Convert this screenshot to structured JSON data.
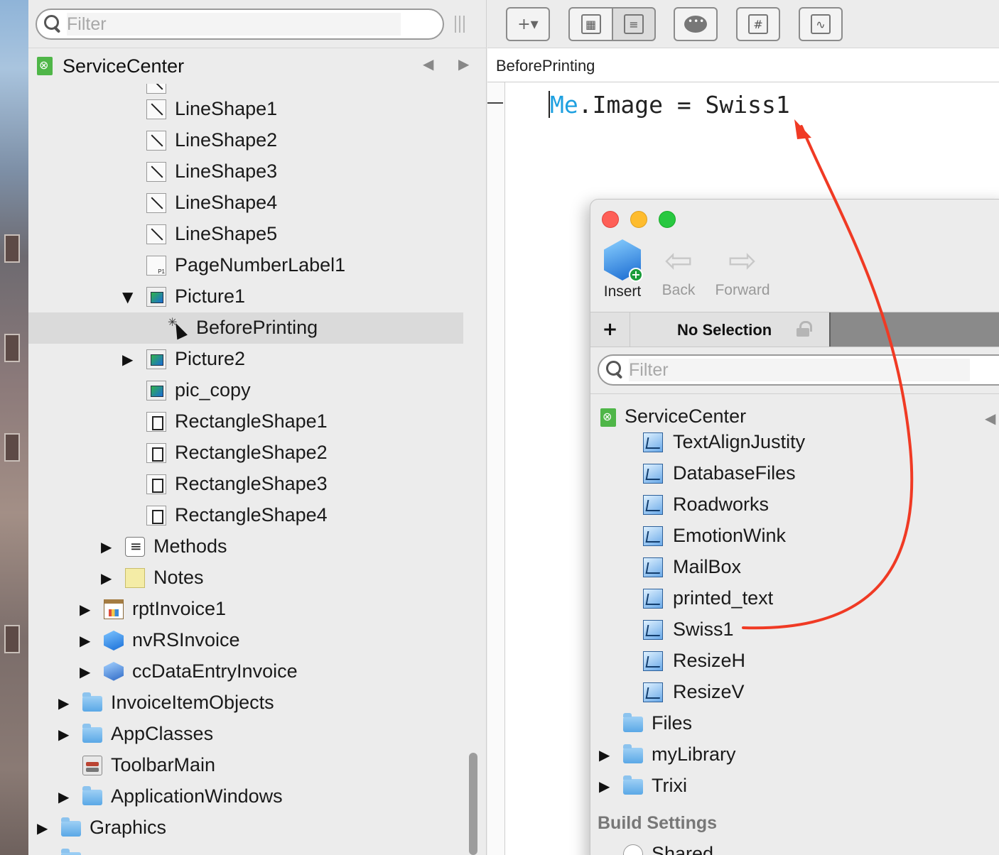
{
  "navigator": {
    "filter_placeholder": "Filter",
    "project_name": "ServiceCenter",
    "items": [
      {
        "label": "LineShape1",
        "icon": "line-shape-icon"
      },
      {
        "label": "LineShape2",
        "icon": "line-shape-icon"
      },
      {
        "label": "LineShape3",
        "icon": "line-shape-icon"
      },
      {
        "label": "LineShape4",
        "icon": "line-shape-icon"
      },
      {
        "label": "LineShape5",
        "icon": "line-shape-icon"
      },
      {
        "label": "PageNumberLabel1",
        "icon": "page-number-label-icon"
      },
      {
        "label": "Picture1",
        "icon": "picture-icon",
        "expanded": true
      },
      {
        "label": "BeforePrinting",
        "icon": "event-handler-icon",
        "selected": true
      },
      {
        "label": "Picture2",
        "icon": "picture-icon"
      },
      {
        "label": "pic_copy",
        "icon": "picture-icon"
      },
      {
        "label": "RectangleShape1",
        "icon": "rectangle-shape-icon"
      },
      {
        "label": "RectangleShape2",
        "icon": "rectangle-shape-icon"
      },
      {
        "label": "RectangleShape3",
        "icon": "rectangle-shape-icon"
      },
      {
        "label": "RectangleShape4",
        "icon": "rectangle-shape-icon"
      },
      {
        "label": "Methods",
        "icon": "methods-icon"
      },
      {
        "label": "Notes",
        "icon": "notes-icon"
      },
      {
        "label": "rptInvoice1",
        "icon": "report-icon"
      },
      {
        "label": "nvRSInvoice",
        "icon": "cube-icon"
      },
      {
        "label": "ccDataEntryInvoice",
        "icon": "container-control-icon"
      },
      {
        "label": "InvoiceItemObjects",
        "icon": "folder-icon"
      },
      {
        "label": "AppClasses",
        "icon": "folder-icon"
      },
      {
        "label": "ToolbarMain",
        "icon": "toolbar-icon"
      },
      {
        "label": "ApplicationWindows",
        "icon": "folder-icon"
      },
      {
        "label": "Graphics",
        "icon": "folder-icon"
      }
    ]
  },
  "editor": {
    "path": "BeforePrinting",
    "code": {
      "keyword": "Me",
      "rest": ".Image = Swiss1"
    }
  },
  "toolbar": {
    "add_icon": "add-dropdown-icon",
    "grid_icon": "grid-icon",
    "list_icon": "list-icon",
    "comment_icon": "comment-icon",
    "hash_icon": "hash-icon",
    "wave_icon": "waveform-icon"
  },
  "library": {
    "insert_label": "Insert",
    "back_label": "Back",
    "forward_label": "Forward",
    "add_label": "+",
    "selection_label": "No Selection",
    "filter_placeholder": "Filter",
    "project_name": "ServiceCenter",
    "items": [
      {
        "label": "TextAlignJustity",
        "icon": "image-set-icon"
      },
      {
        "label": "DatabaseFiles",
        "icon": "image-set-icon"
      },
      {
        "label": "Roadworks",
        "icon": "image-set-icon"
      },
      {
        "label": "EmotionWink",
        "icon": "image-set-icon"
      },
      {
        "label": "MailBox",
        "icon": "image-set-icon"
      },
      {
        "label": "printed_text",
        "icon": "image-set-icon"
      },
      {
        "label": "Swiss1",
        "icon": "image-set-icon"
      },
      {
        "label": "ResizeH",
        "icon": "image-set-icon"
      },
      {
        "label": "ResizeV",
        "icon": "image-set-icon"
      },
      {
        "label": "Files",
        "icon": "folder-icon"
      },
      {
        "label": "myLibrary",
        "icon": "folder-icon"
      },
      {
        "label": "Trixi",
        "icon": "folder-icon"
      }
    ],
    "build_settings_label": "Build Settings",
    "shared_label": "Shared"
  },
  "colors": {
    "keyword": "#1ea0e0",
    "annotation_arrow": "#f03a24",
    "project_icon": "#4fb648"
  }
}
